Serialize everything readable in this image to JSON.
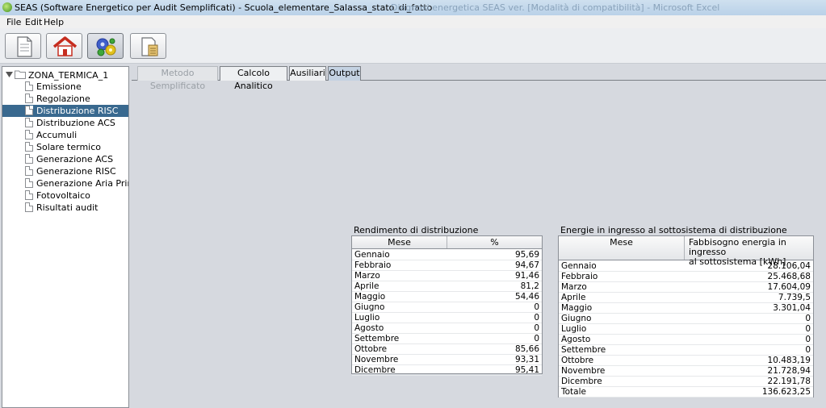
{
  "window": {
    "title": "SEAS (Software Energetico per Audit Semplificati) - Scuola_elementare_Salassa_stato_di_fatto",
    "background_title": "Diagnosi energetica SEAS ver. [Modalità di compatibilità] - Microsoft Excel"
  },
  "menu": [
    "File",
    "Edit",
    "Help"
  ],
  "toolbar": {
    "buttons": [
      {
        "icon": "document-icon"
      },
      {
        "icon": "home-icon"
      },
      {
        "icon": "gears-icon",
        "active": true
      },
      {
        "icon": "report-icon"
      }
    ]
  },
  "tree": {
    "root": "ZONA_TERMICA_1",
    "items": [
      "Emissione",
      "Regolazione",
      "Distribuzione RISC",
      "Distribuzione ACS",
      "Accumuli",
      "Solare termico",
      "Generazione ACS",
      "Generazione RISC",
      "Generazione Aria Primaria",
      "Fotovoltaico",
      "Risultati audit"
    ],
    "selected_index": 2
  },
  "tabs": [
    {
      "label": "Metodo Semplificato",
      "disabled": true
    },
    {
      "label": "Calcolo Analitico"
    },
    {
      "label": "Ausiliari"
    },
    {
      "label": "Output",
      "active": true
    }
  ],
  "table_rendimento": {
    "title": "Rendimento di distribuzione",
    "columns": [
      "Mese",
      "%"
    ],
    "rows": [
      [
        "Gennaio",
        "95,69"
      ],
      [
        "Febbraio",
        "94,67"
      ],
      [
        "Marzo",
        "91,46"
      ],
      [
        "Aprile",
        "81,2"
      ],
      [
        "Maggio",
        "54,46"
      ],
      [
        "Giugno",
        "0"
      ],
      [
        "Luglio",
        "0"
      ],
      [
        "Agosto",
        "0"
      ],
      [
        "Settembre",
        "0"
      ],
      [
        "Ottobre",
        "85,66"
      ],
      [
        "Novembre",
        "93,31"
      ],
      [
        "Dicembre",
        "95,41"
      ]
    ]
  },
  "table_energie": {
    "title": "Energie in ingresso al sottosistema di distribuzione",
    "columns": [
      "Mese",
      "Fabbisogno energia in ingresso",
      "al sottosistema [kWh]"
    ],
    "rows": [
      [
        "Gennaio",
        "28.106,04"
      ],
      [
        "Febbraio",
        "25.468,68"
      ],
      [
        "Marzo",
        "17.604,09"
      ],
      [
        "Aprile",
        "7.739,5"
      ],
      [
        "Maggio",
        "3.301,04"
      ],
      [
        "Giugno",
        "0"
      ],
      [
        "Luglio",
        "0"
      ],
      [
        "Agosto",
        "0"
      ],
      [
        "Settembre",
        "0"
      ],
      [
        "Ottobre",
        "10.483,19"
      ],
      [
        "Novembre",
        "21.728,94"
      ],
      [
        "Dicembre",
        "22.191,78"
      ],
      [
        "Totale",
        "136.623,25"
      ]
    ]
  }
}
